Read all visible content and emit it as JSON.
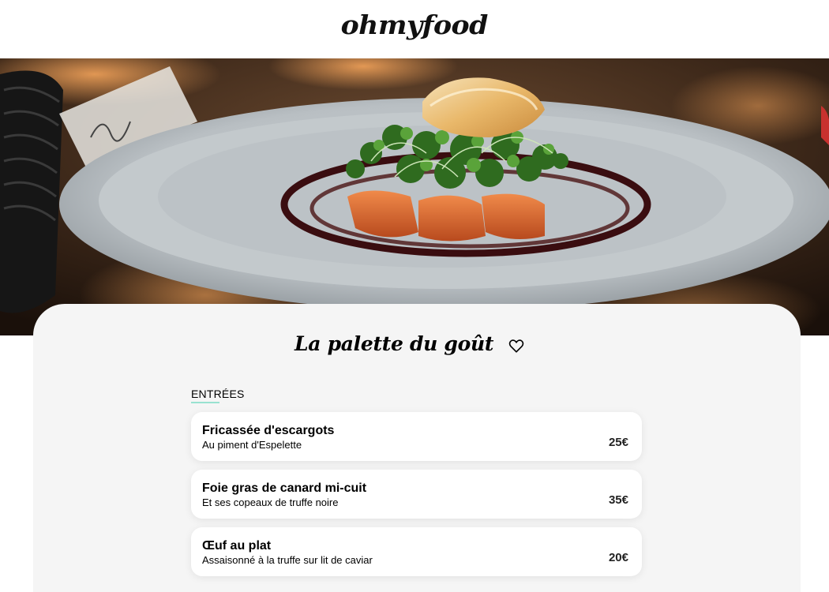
{
  "header": {
    "logo": "ohmyfood"
  },
  "hero": {
    "alt": "Plated fish with microgreens on a white plate"
  },
  "restaurant": {
    "name": "La palette du goût",
    "favorite_icon": "heart-outline-icon"
  },
  "menu": {
    "section_title": "ENTRÉES",
    "accent_color": "#99e2d0",
    "items": [
      {
        "name": "Fricassée d'escargots",
        "description": "Au piment d'Espelette",
        "price": "25€"
      },
      {
        "name": "Foie gras de canard mi-cuit",
        "description": "Et ses copeaux de truffe noire",
        "price": "35€"
      },
      {
        "name": "Œuf au plat",
        "description": "Assaisonné à la truffe sur lit de caviar",
        "price": "20€"
      }
    ]
  }
}
